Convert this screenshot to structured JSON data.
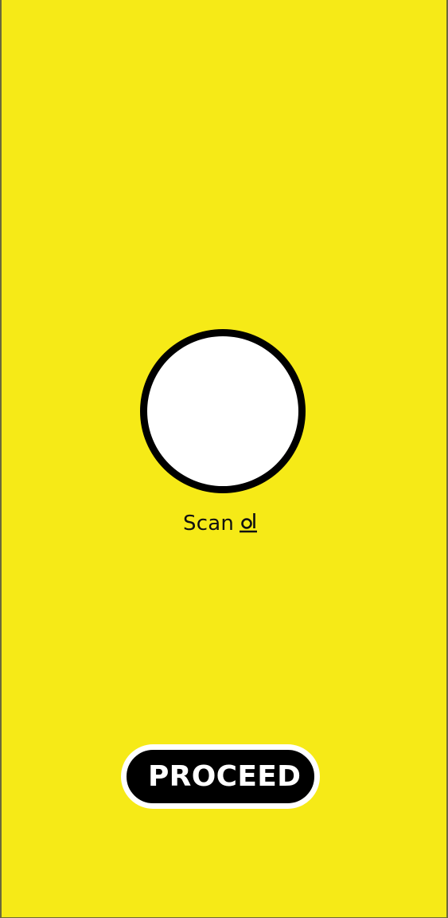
{
  "colors": {
    "background": "#f6ea17",
    "circle_fill": "#ffffff",
    "circle_border": "#000000",
    "button_fill": "#000000",
    "button_border": "#ffffff",
    "button_text": "#ffffff"
  },
  "scan": {
    "label": "Scan",
    "icon": "scan-icon"
  },
  "actions": {
    "proceed_label": "PROCEED"
  }
}
